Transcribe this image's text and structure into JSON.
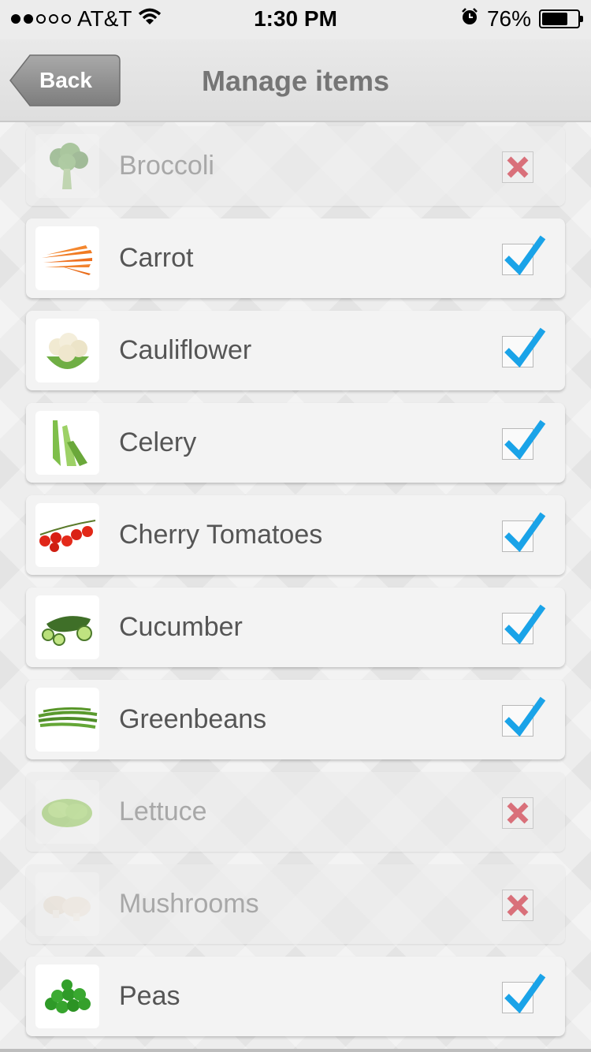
{
  "status_bar": {
    "carrier": "AT&T",
    "time": "1:30 PM",
    "battery_percent": "76%",
    "battery_level": 0.76,
    "signal_bars_filled": 2,
    "signal_bars_total": 5
  },
  "nav": {
    "back_label": "Back",
    "title": "Manage items"
  },
  "colors": {
    "check": "#1aa3e8",
    "cross": "#d9707a"
  },
  "items": [
    {
      "label": "Broccoli",
      "checked": false,
      "icon": "broccoli-image"
    },
    {
      "label": "Carrot",
      "checked": true,
      "icon": "carrot-image"
    },
    {
      "label": "Cauliflower",
      "checked": true,
      "icon": "cauliflower-image"
    },
    {
      "label": "Celery",
      "checked": true,
      "icon": "celery-image"
    },
    {
      "label": "Cherry Tomatoes",
      "checked": true,
      "icon": "cherry-tomatoes-image"
    },
    {
      "label": "Cucumber",
      "checked": true,
      "icon": "cucumber-image"
    },
    {
      "label": "Greenbeans",
      "checked": true,
      "icon": "greenbeans-image"
    },
    {
      "label": "Lettuce",
      "checked": false,
      "icon": "lettuce-image"
    },
    {
      "label": "Mushrooms",
      "checked": false,
      "icon": "mushrooms-image"
    },
    {
      "label": "Peas",
      "checked": true,
      "icon": "peas-image"
    }
  ]
}
